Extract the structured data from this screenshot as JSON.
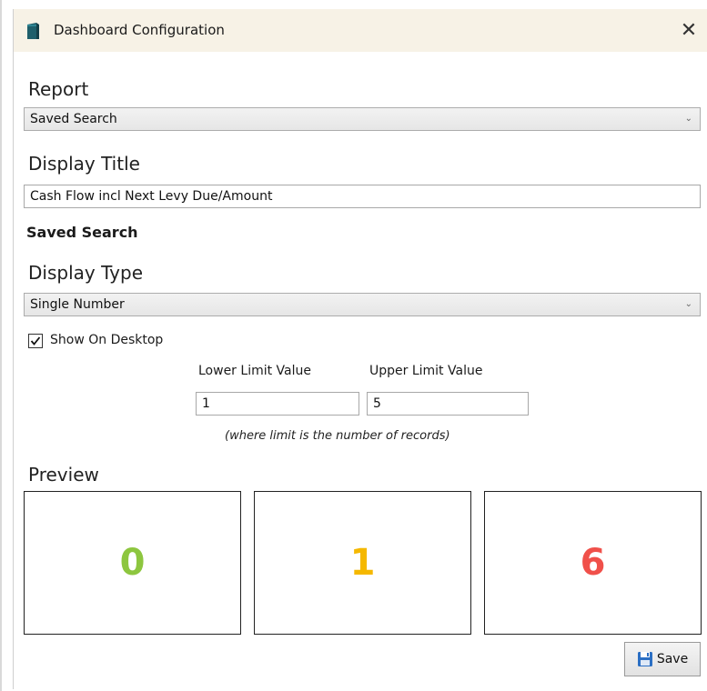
{
  "window": {
    "title": "Dashboard Configuration",
    "close_glyph": "✕"
  },
  "report": {
    "label": "Report",
    "selected": "Saved Search"
  },
  "display_title": {
    "label": "Display Title",
    "value": "Cash Flow incl Next Levy Due/Amount"
  },
  "saved_search_label": "Saved Search",
  "display_type": {
    "label": "Display Type",
    "selected": "Single Number"
  },
  "show_on_desktop": {
    "label": "Show On Desktop",
    "checked": true
  },
  "limits": {
    "lower_label": "Lower Limit Value",
    "lower_value": "1",
    "upper_label": "Upper Limit Value",
    "upper_value": "5",
    "hint": "(where limit is the number of records)"
  },
  "preview": {
    "label": "Preview",
    "boxes": [
      {
        "value": "0",
        "color": "#8dc63f"
      },
      {
        "value": "1",
        "color": "#f5b800"
      },
      {
        "value": "6",
        "color": "#f0504a"
      }
    ]
  },
  "save_button": {
    "label": "Save",
    "icon": "floppy-disk-icon"
  },
  "colors": {
    "titlebar_bg": "#f7f2e6",
    "icon_teal": "#1f5f6b"
  }
}
